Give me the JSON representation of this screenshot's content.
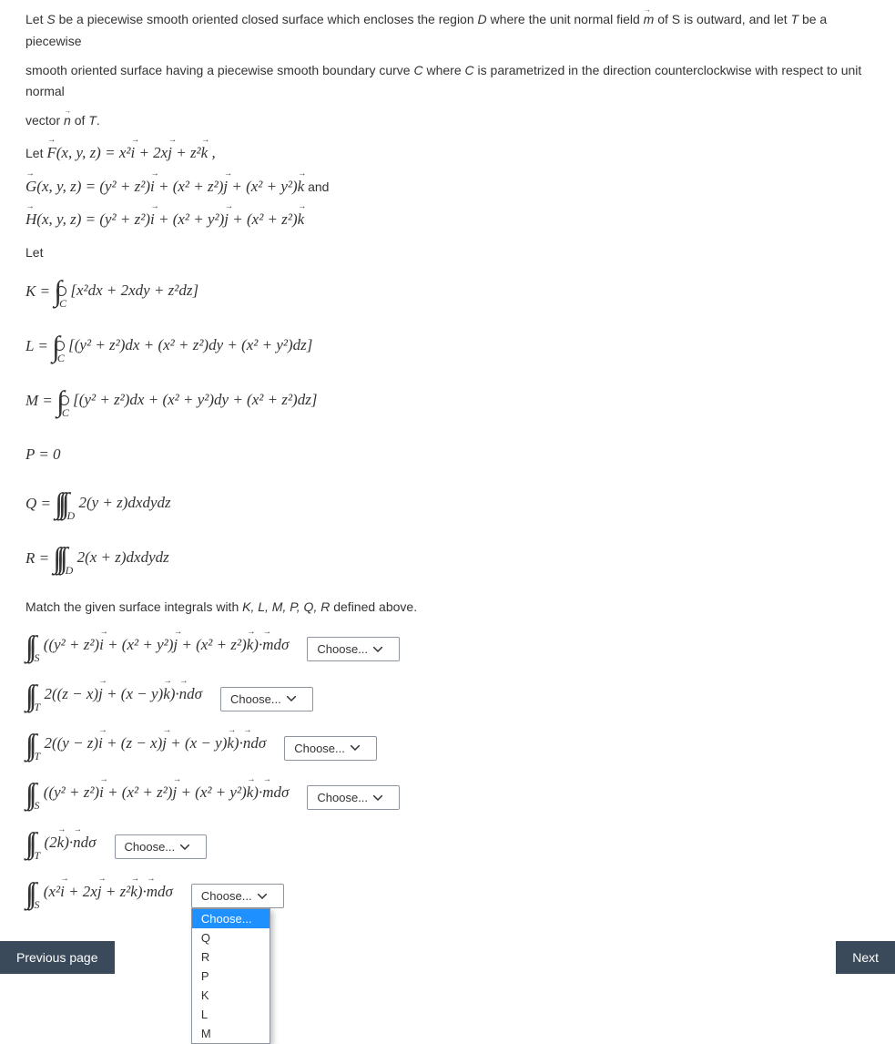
{
  "intro": {
    "p1_a": "Let ",
    "p1_b": " be a piecewise smooth oriented closed surface which encloses the region ",
    "p1_c": " where the unit normal field ",
    "p1_d": " of S is outward, and let ",
    "p1_e": " be a piecewise",
    "p2_a": "smooth oriented surface having a piecewise smooth boundary curve ",
    "p2_b": " where ",
    "p2_c": " is parametrized in the direction counterclockwise with respect to unit normal",
    "p3_a": "vector ",
    "p3_b": " of ",
    "p3_c": "."
  },
  "sym": {
    "S": "S",
    "D": "D",
    "m": "m",
    "T": "T",
    "C": "C",
    "n": "n",
    "F": "F",
    "G": "G",
    "H": "H"
  },
  "defs": {
    "let": "Let  ",
    "F": "(x, y, z) = x² i + 2x j + z² k ,",
    "G": "(x, y, z) = (y² + z²) i + (x² + z²) j + (x² + y²) k",
    "and": " and",
    "H": "(x, y, z) = (y² + z²) i + (x² + y²) j + (x² + z²) k",
    "let2": "Let"
  },
  "eqs": {
    "K_lhs": "K = ",
    "K_body": "[x²dx + 2xdy + z²dz]",
    "L_lhs": "L = ",
    "L_body": "[(y² + z²)dx + (x² + z²)dy + (x² + y²)dz]",
    "M_lhs": "M = ",
    "M_body": "[(y² + z²)dx + (x² + y²)dy + (x² + z²)dz]",
    "P": "P = 0",
    "Q_lhs": "Q = ",
    "Q_body": "2(y + z)dxdydz",
    "R_lhs": "R = ",
    "R_body": "2(x + z)dxdydz"
  },
  "match": "Match the given surface integrals with K, L, M, P, Q, R defined above.",
  "rows": [
    {
      "expr": "((y² + z²) i + (x² + y²) j + (x² + z²) k)· m dσ",
      "sub": "S",
      "d": 2
    },
    {
      "expr": "2((z − x) j + (x − y) k)· n dσ",
      "sub": "T",
      "d": 2
    },
    {
      "expr": "2((y − z) i + (z − x) j + (x − y) k)· n dσ",
      "sub": "T",
      "d": 2
    },
    {
      "expr": "((y² + z²) i + (x² + z²) j + (x² + y²) k)· m dσ",
      "sub": "S",
      "d": 2
    },
    {
      "expr": "(2 k)· n dσ",
      "sub": "T",
      "d": 2
    },
    {
      "expr": "(x² i + 2x j + z² k)· m dσ",
      "sub": "S",
      "d": 2
    }
  ],
  "select": {
    "placeholder": "Choose...",
    "options": [
      "Choose...",
      "Q",
      "R",
      "P",
      "K",
      "L",
      "M"
    ]
  },
  "nav": {
    "prev": "Previous page",
    "next": "Next"
  }
}
